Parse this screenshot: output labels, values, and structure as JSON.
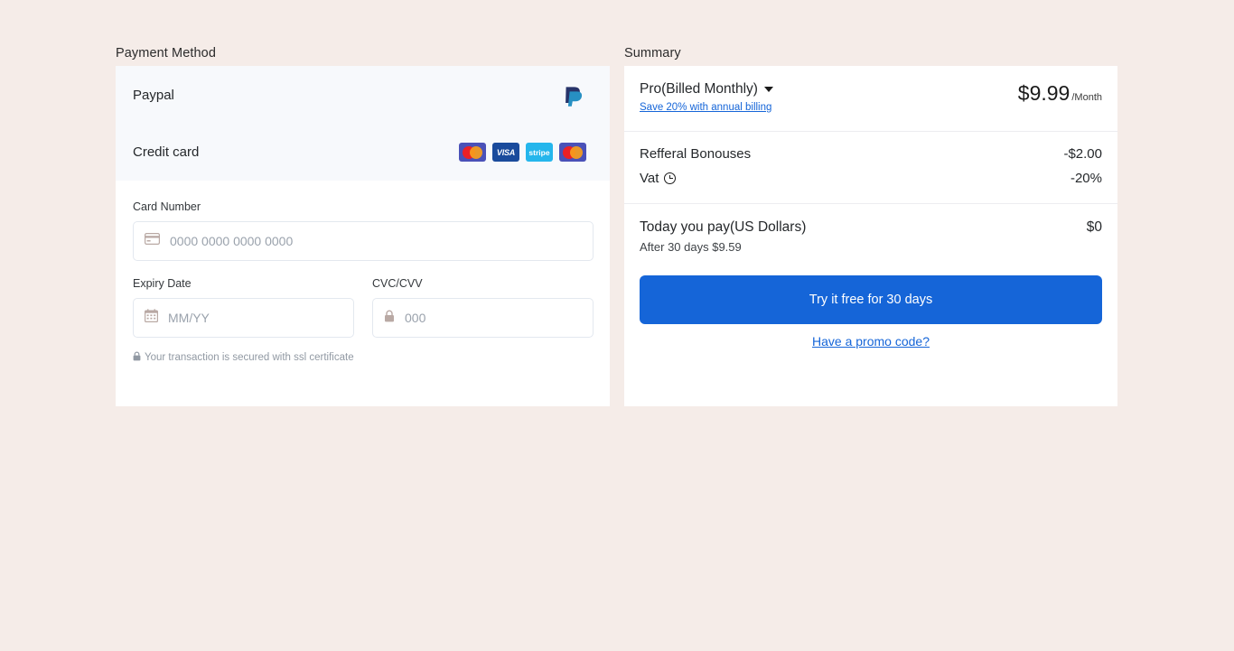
{
  "page": {
    "background_color": "#f5ece8",
    "accent_color": "#1565d8"
  },
  "payment_section": {
    "caption": "Payment Method",
    "methods": [
      {
        "label": "Paypal",
        "icon": "paypal-logo"
      },
      {
        "label": "Credit card",
        "brands": [
          {
            "name": "mastercard-icon",
            "text": ""
          },
          {
            "name": "visa-icon",
            "text": "VISA"
          },
          {
            "name": "stripe-icon",
            "text": "stripe"
          },
          {
            "name": "mastercard-icon",
            "text": ""
          }
        ]
      }
    ],
    "form": {
      "card_number": {
        "label": "Card Number",
        "placeholder": "0000 0000 0000 0000",
        "value": "",
        "icon": "credit-card-icon"
      },
      "expiry": {
        "label": "Expiry Date",
        "placeholder": "MM/YY",
        "value": "",
        "icon": "calendar-icon"
      },
      "cvc": {
        "label": "CVC/CVV",
        "placeholder": "000",
        "value": "",
        "icon": "lock-icon"
      },
      "ssl_note": "Your transaction is secured with ssl certificate"
    }
  },
  "summary_section": {
    "caption": "Summary",
    "plan": {
      "name": "Pro(Billed Monthly)",
      "annual_link": "Save 20% with annual billing",
      "price": "$9.99",
      "period": "/Month"
    },
    "line_items": [
      {
        "label": "Refferal Bonouses",
        "value": "-$2.00",
        "icon": ""
      },
      {
        "label": "Vat",
        "value": "-20%",
        "icon": "clock-icon"
      }
    ],
    "total": {
      "label": "Today you pay(US Dollars)",
      "value": "$0",
      "note": "After 30 days $9.59"
    },
    "cta_label": "Try it free for 30 days",
    "promo_label": "Have a promo code?"
  }
}
